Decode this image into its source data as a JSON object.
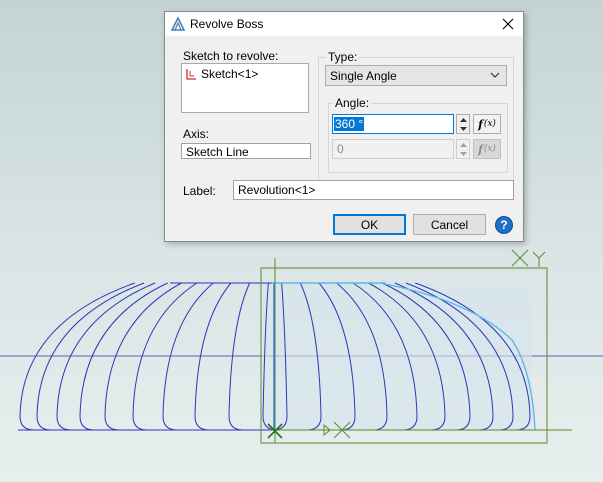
{
  "dialog": {
    "title": "Revolve Boss",
    "sketch_label": "Sketch to revolve:",
    "sketch_item": "Sketch<1>",
    "axis_label": "Axis:",
    "axis_value": "Sketch Line",
    "type_label": "Type:",
    "type_value": "Single Angle",
    "angle_label": "Angle:",
    "angle_value": "360 °",
    "angle2_value": "0",
    "fx_label": "(x)",
    "name_label": "Label:",
    "name_value": "Revolution<1>",
    "ok_label": "OK",
    "cancel_label": "Cancel",
    "help_label": "?"
  },
  "viewport": {
    "triad_y": "Y",
    "triad_x": "X"
  },
  "colors": {
    "model_outline": "#2a38b8",
    "sketch_green": "#5a8c2a",
    "preview_cyan": "#5fb6e8",
    "selection_blue": "#0078d7"
  }
}
